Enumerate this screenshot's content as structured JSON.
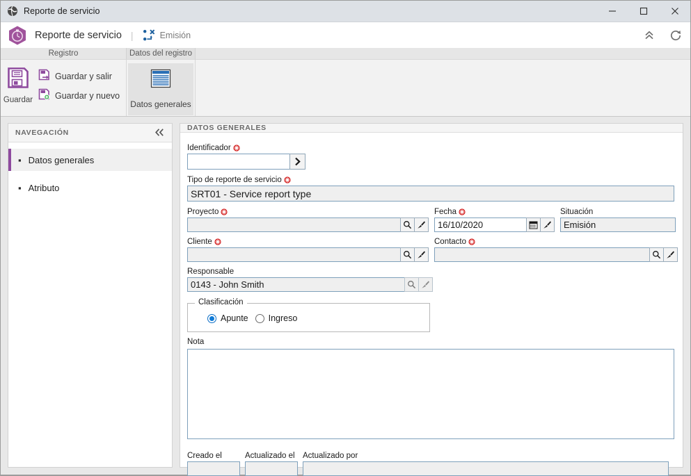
{
  "titlebar": {
    "title": "Reporte de servicio",
    "icon": "globe-icon",
    "minimize": "–",
    "maximize": "□",
    "close": "×"
  },
  "app_header": {
    "logo": "stopwatch-hexagon-logo",
    "title": "Reporte de servicio",
    "separator": "|",
    "status_icon": "workflow-icon",
    "status_label": "Emisión",
    "collapse_icon": "chevrons-up-icon",
    "refresh_icon": "refresh-icon",
    "accent_color": "#a0539c"
  },
  "ribbon": {
    "groups": [
      {
        "name": "Registro",
        "big_button": {
          "label": "Guardar",
          "icon": "floppy-disk-icon"
        },
        "small_buttons": [
          {
            "label": "Guardar y salir",
            "icon": "save-exit-icon"
          },
          {
            "label": "Guardar y nuevo",
            "icon": "save-new-icon"
          }
        ]
      },
      {
        "name": "Datos del registro",
        "tab_button": {
          "label": "Datos generales",
          "icon": "document-lines-icon",
          "selected": true
        }
      }
    ]
  },
  "navigation": {
    "header": "NAVEGACIÓN",
    "collapse_icon": "chevrons-left-icon",
    "items": [
      {
        "label": "Datos generales",
        "selected": true
      },
      {
        "label": "Atributo",
        "selected": false
      }
    ]
  },
  "content": {
    "header": "DATOS GENERALES",
    "fields": {
      "identificador": {
        "label": "Identificador",
        "required": true,
        "value": "",
        "button_icon": "chevron-right-icon"
      },
      "tipo_reporte": {
        "label": "Tipo de reporte de servicio",
        "required": true,
        "value": "SRT01 - Service report type",
        "readonly": true
      },
      "proyecto": {
        "label": "Proyecto",
        "required": true,
        "value": "",
        "readonly": true,
        "icons": [
          "magnifier-icon",
          "brush-icon"
        ]
      },
      "fecha": {
        "label": "Fecha",
        "required": true,
        "value": "16/10/2020",
        "icons": [
          "calendar-icon",
          "brush-icon"
        ]
      },
      "situacion": {
        "label": "Situación",
        "required": false,
        "value": "Emisión",
        "readonly": true
      },
      "cliente": {
        "label": "Cliente",
        "required": true,
        "value": "",
        "readonly": true,
        "icons": [
          "magnifier-icon",
          "brush-icon"
        ]
      },
      "contacto": {
        "label": "Contacto",
        "required": true,
        "value": "",
        "readonly": true,
        "icons": [
          "magnifier-icon",
          "brush-icon"
        ]
      },
      "responsable": {
        "label": "Responsable",
        "required": false,
        "value": "0143 - John Smith",
        "readonly": true,
        "icons": [
          "magnifier-icon",
          "brush-icon"
        ]
      },
      "clasificacion": {
        "caption": "Clasificación",
        "options": [
          {
            "label": "Apunte",
            "selected": true
          },
          {
            "label": "Ingreso",
            "selected": false
          }
        ]
      },
      "nota": {
        "label": "Nota",
        "value": ""
      },
      "creado_el": {
        "label": "Creado el",
        "value": "",
        "readonly": true
      },
      "actualizado_el": {
        "label": "Actualizado el",
        "value": "",
        "readonly": true
      },
      "actualizado_por": {
        "label": "Actualizado por",
        "value": "",
        "readonly": true
      }
    }
  }
}
